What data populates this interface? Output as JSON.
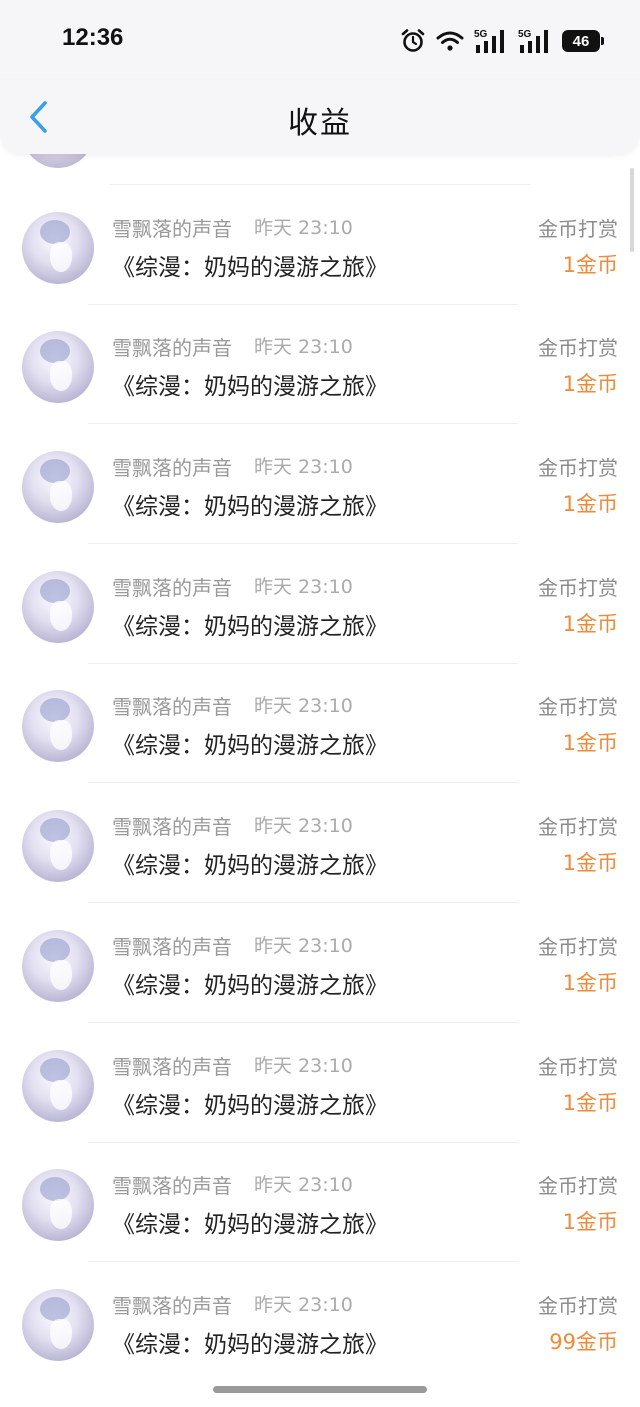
{
  "status_bar": {
    "time": "12:36",
    "network_1": "5G",
    "network_2": "5G",
    "battery": "46",
    "icons": [
      "alarm-icon",
      "wifi-icon",
      "signal-icon",
      "signal-icon",
      "battery-icon"
    ]
  },
  "nav": {
    "back_icon": "chevron-left-icon",
    "title": "收益",
    "accent": "#3aa0e8"
  },
  "colors": {
    "amount": "#ef8a3a",
    "meta": "#9a9a9a"
  },
  "records": [
    {
      "name": "雪飘落的声音",
      "time": "昨天 23:10",
      "title": "《综漫：奶妈的漫游之旅》",
      "type": "金币打赏",
      "amount": "1金币"
    },
    {
      "name": "雪飘落的声音",
      "time": "昨天 23:10",
      "title": "《综漫：奶妈的漫游之旅》",
      "type": "金币打赏",
      "amount": "1金币"
    },
    {
      "name": "雪飘落的声音",
      "time": "昨天 23:10",
      "title": "《综漫：奶妈的漫游之旅》",
      "type": "金币打赏",
      "amount": "1金币"
    },
    {
      "name": "雪飘落的声音",
      "time": "昨天 23:10",
      "title": "《综漫：奶妈的漫游之旅》",
      "type": "金币打赏",
      "amount": "1金币"
    },
    {
      "name": "雪飘落的声音",
      "time": "昨天 23:10",
      "title": "《综漫：奶妈的漫游之旅》",
      "type": "金币打赏",
      "amount": "1金币"
    },
    {
      "name": "雪飘落的声音",
      "time": "昨天 23:10",
      "title": "《综漫：奶妈的漫游之旅》",
      "type": "金币打赏",
      "amount": "1金币"
    },
    {
      "name": "雪飘落的声音",
      "time": "昨天 23:10",
      "title": "《综漫：奶妈的漫游之旅》",
      "type": "金币打赏",
      "amount": "1金币"
    },
    {
      "name": "雪飘落的声音",
      "time": "昨天 23:10",
      "title": "《综漫：奶妈的漫游之旅》",
      "type": "金币打赏",
      "amount": "1金币"
    },
    {
      "name": "雪飘落的声音",
      "time": "昨天 23:10",
      "title": "《综漫：奶妈的漫游之旅》",
      "type": "金币打赏",
      "amount": "1金币"
    },
    {
      "name": "雪飘落的声音",
      "time": "昨天 23:10",
      "title": "《综漫：奶妈的漫游之旅》",
      "type": "金币打赏",
      "amount": "99金币"
    }
  ]
}
